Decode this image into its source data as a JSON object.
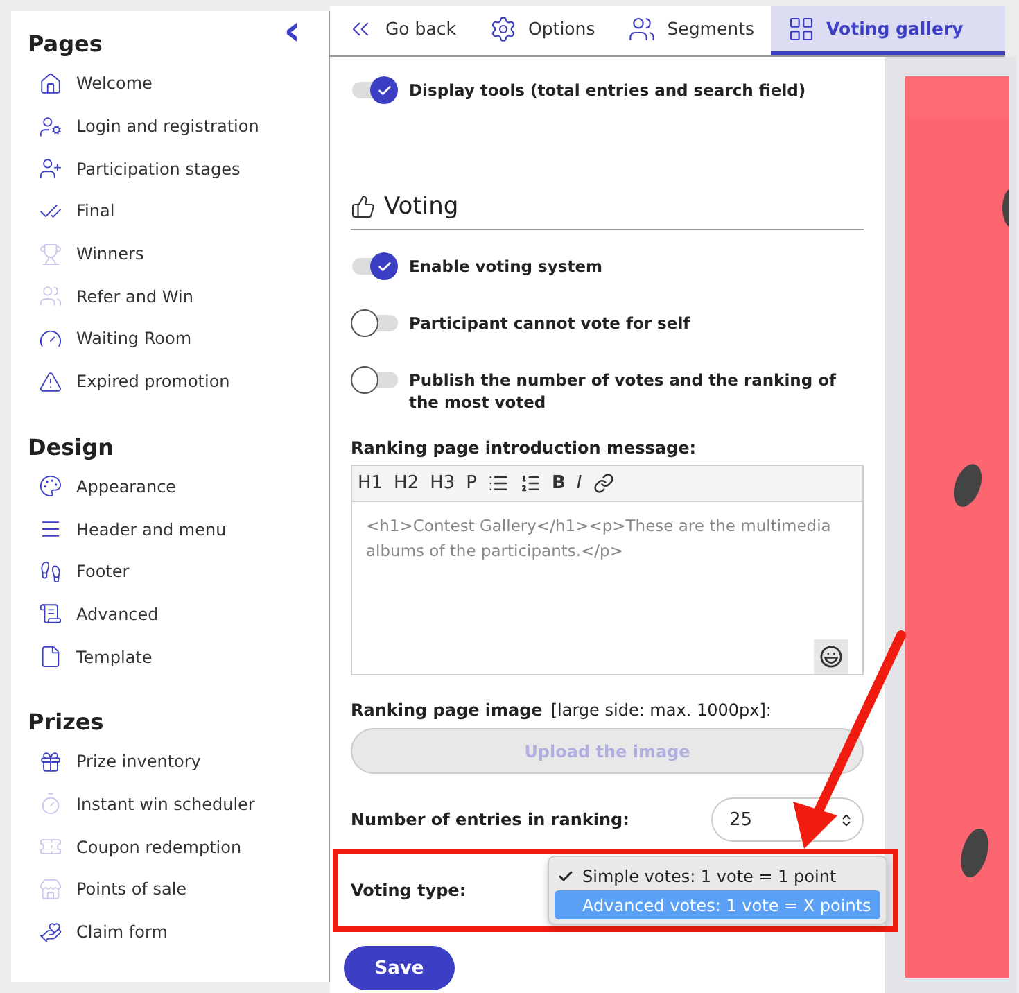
{
  "sidebar": {
    "collapse_icon": "‹",
    "sections": [
      {
        "title": "Pages",
        "items": [
          {
            "label": "Welcome",
            "dimmed": false
          },
          {
            "label": "Login and registration",
            "dimmed": false
          },
          {
            "label": "Participation stages",
            "dimmed": false
          },
          {
            "label": "Final",
            "dimmed": false
          },
          {
            "label": "Winners",
            "dimmed": true
          },
          {
            "label": "Refer and Win",
            "dimmed": true
          },
          {
            "label": "Waiting Room",
            "dimmed": false
          },
          {
            "label": "Expired promotion",
            "dimmed": false
          }
        ]
      },
      {
        "title": "Design",
        "items": [
          {
            "label": "Appearance",
            "dimmed": false
          },
          {
            "label": "Header and menu",
            "dimmed": false
          },
          {
            "label": "Footer",
            "dimmed": false
          },
          {
            "label": "Advanced",
            "dimmed": false
          },
          {
            "label": "Template",
            "dimmed": false
          }
        ]
      },
      {
        "title": "Prizes",
        "items": [
          {
            "label": "Prize inventory",
            "dimmed": false
          },
          {
            "label": "Instant win scheduler",
            "dimmed": true
          },
          {
            "label": "Coupon redemption",
            "dimmed": true
          },
          {
            "label": "Points of sale",
            "dimmed": true
          },
          {
            "label": "Claim form",
            "dimmed": false
          }
        ]
      }
    ]
  },
  "tabs": [
    {
      "label": "Go back",
      "selected": false
    },
    {
      "label": "Options",
      "selected": false
    },
    {
      "label": "Segments",
      "selected": false
    },
    {
      "label": "Voting gallery",
      "selected": true
    }
  ],
  "display_tools": {
    "label": "Display tools (total entries and search field)",
    "on": true
  },
  "voting": {
    "title": "Voting",
    "toggles": [
      {
        "label": "Enable voting system",
        "on": true
      },
      {
        "label": "Participant cannot vote for self",
        "on": false
      },
      {
        "label": "Publish the number of votes and the ranking of the most voted",
        "on": false
      }
    ]
  },
  "intro_message": {
    "label": "Ranking page introduction message:",
    "toolbar": [
      "H1",
      "H2",
      "H3",
      "P",
      "B",
      "I"
    ],
    "value": "<h1>Contest Gallery</h1><p>These are the multimedia albums of the participants.</p>"
  },
  "ranking_image": {
    "label": "Ranking page image",
    "hint": "[large side: max. 1000px]:",
    "button": "Upload the image"
  },
  "entries_in_ranking": {
    "label": "Number of entries in ranking:",
    "value": "25"
  },
  "voting_type": {
    "label": "Voting type:",
    "options": [
      {
        "label": "Simple votes: 1 vote = 1 point",
        "selected": true,
        "highlighted": false
      },
      {
        "label": "Advanced votes: 1 vote = X points",
        "selected": false,
        "highlighted": true
      }
    ]
  },
  "save_button": "Save"
}
